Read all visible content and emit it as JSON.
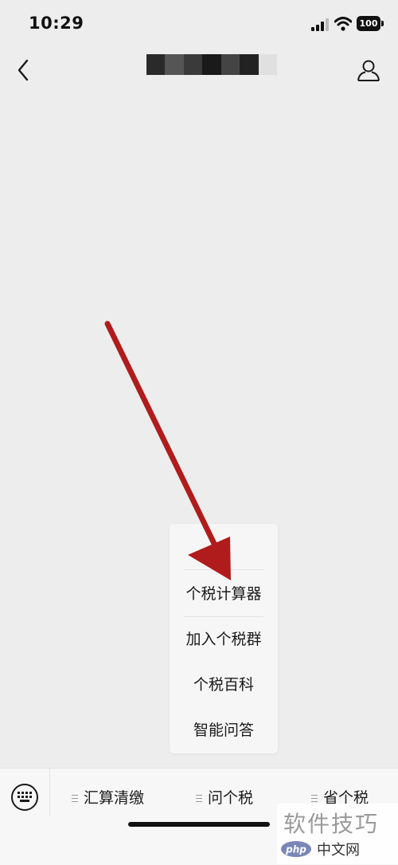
{
  "status_bar": {
    "time": "10:29",
    "battery": "100",
    "icons": [
      "signal-icon",
      "wifi-icon",
      "battery-icon"
    ]
  },
  "nav": {
    "icons": [
      "back-icon",
      "profile-icon"
    ],
    "title_mosaic_colors": [
      "#2a2a2a",
      "#555555",
      "#3a3a3a",
      "#1a1a1a",
      "#444444",
      "#222222",
      "#e0e0e0"
    ]
  },
  "annotation": {
    "arrow_color": "#b01c1c"
  },
  "popup_menu": {
    "items": [
      "个税计算器",
      "加入个税群",
      "个税百科",
      "智能问答"
    ]
  },
  "bottom_bar": {
    "keyboard_icon": "keyboard-icon",
    "tabs": [
      {
        "label": "汇算清缴",
        "icon": "menu-icon"
      },
      {
        "label": "问个税",
        "icon": "menu-icon"
      },
      {
        "label": "省个税",
        "icon": "menu-icon"
      }
    ]
  },
  "watermark": {
    "text": "软件技巧",
    "logo": "php",
    "sub": "中文网"
  }
}
